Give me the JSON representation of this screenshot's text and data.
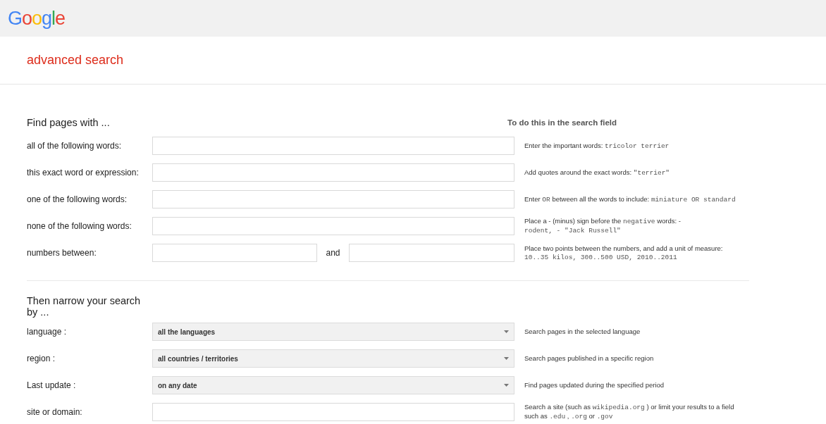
{
  "header": {
    "logo": "Google"
  },
  "page_title": "advanced search",
  "sections": [
    {
      "heading": "Find pages with ...",
      "side_heading": "To do this in the search field",
      "rows": [
        {
          "kind": "text",
          "label": "all of the following words:",
          "hint": [
            {
              "text": "Enter the important words: ",
              "mono": false
            },
            {
              "text": "tricolor terrier",
              "mono": true
            }
          ]
        },
        {
          "kind": "text",
          "label": "this exact word or expression:",
          "hint": [
            {
              "text": "Add quotes around the exact words: ",
              "mono": false
            },
            {
              "text": "\"terrier\"",
              "mono": true
            }
          ]
        },
        {
          "kind": "text",
          "label": "one of the following words:",
          "hint": [
            {
              "text": "Enter ",
              "mono": false
            },
            {
              "text": "OR",
              "mono": true
            },
            {
              "text": " between all the words to include: ",
              "mono": false
            },
            {
              "text": "miniature OR standard",
              "mono": true
            }
          ]
        },
        {
          "kind": "text",
          "label": "none of the following words:",
          "hint": [
            {
              "text": "Place a - (minus) sign before the ",
              "mono": false
            },
            {
              "text": "negative",
              "mono": true
            },
            {
              "text": " words: -",
              "mono": false
            },
            {
              "text": "rodent, - \"Jack Russell\"",
              "mono": true,
              "break": true
            }
          ]
        },
        {
          "kind": "range",
          "label": "numbers between:",
          "joiner": "and",
          "hint": [
            {
              "text": "Place two points between the numbers, and add a unit of measure:",
              "mono": false
            },
            {
              "text": "10..35 kilos, 300..500 USD, 2010..2011",
              "mono": true,
              "break": true
            }
          ]
        }
      ]
    },
    {
      "heading": "Then narrow your search by ...",
      "rows": [
        {
          "kind": "select",
          "label": "language :",
          "value": "all the languages",
          "hint": [
            {
              "text": "Search pages in the selected language",
              "mono": false
            }
          ]
        },
        {
          "kind": "select",
          "label": "region :",
          "value": "all countries / territories",
          "hint": [
            {
              "text": "Search pages published in a specific region",
              "mono": false
            }
          ]
        },
        {
          "kind": "select",
          "label": "Last update :",
          "value": "on any date",
          "hint": [
            {
              "text": "Find pages updated during the specified period",
              "mono": false
            }
          ]
        },
        {
          "kind": "text",
          "label": "site or domain:",
          "hint": [
            {
              "text": "Search a site (such as ",
              "mono": false
            },
            {
              "text": "wikipedia.org",
              "mono": true
            },
            {
              "text": " ) or limit your results to a field",
              "mono": false
            },
            {
              "text": "such as ",
              "mono": false,
              "break": true
            },
            {
              "text": ".edu",
              "mono": true
            },
            {
              "text": " , ",
              "mono": false
            },
            {
              "text": ".org",
              "mono": true
            },
            {
              "text": " or ",
              "mono": false
            },
            {
              "text": ".gov",
              "mono": true
            }
          ]
        }
      ]
    }
  ]
}
